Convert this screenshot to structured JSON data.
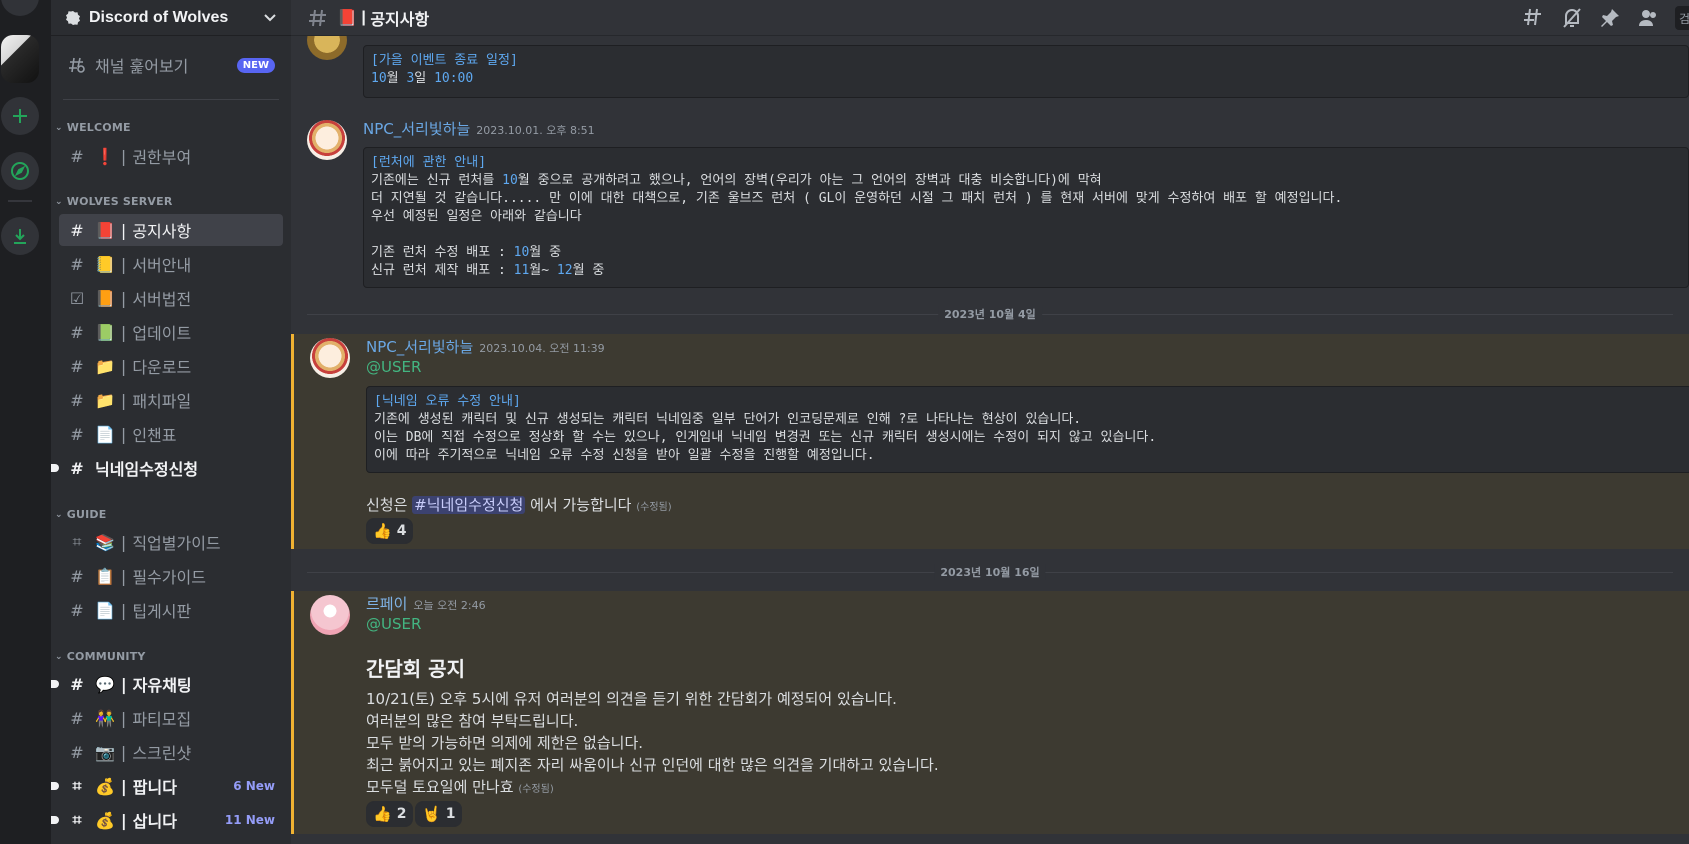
{
  "guild": {
    "name": "Discord of Wolves"
  },
  "sidebar": {
    "browse": {
      "label": "채널 훑어보기",
      "badge": "NEW"
    },
    "categories": [
      {
        "label": "WELCOME"
      },
      {
        "label": "WOLVES SERVER"
      },
      {
        "label": "GUIDE"
      },
      {
        "label": "COMMUNITY"
      }
    ],
    "channels": [
      {
        "label": "권한부여",
        "emoji": "❗"
      },
      {
        "label": "공지사항",
        "emoji": "📕"
      },
      {
        "label": "서버안내",
        "emoji": "📒"
      },
      {
        "label": "서버법전",
        "emoji": "📙"
      },
      {
        "label": "업데이트",
        "emoji": "📗"
      },
      {
        "label": "다운로드",
        "emoji": "📁"
      },
      {
        "label": "패치파일",
        "emoji": "📁"
      },
      {
        "label": "인챈표",
        "emoji": "📄"
      },
      {
        "label": "닉네임수정신청",
        "emoji": ""
      },
      {
        "label": "직업별가이드",
        "emoji": "📚"
      },
      {
        "label": "필수가이드",
        "emoji": "📋"
      },
      {
        "label": "팁게시판",
        "emoji": "📄"
      },
      {
        "label": "자유채팅",
        "emoji": "💬"
      },
      {
        "label": "파티모집",
        "emoji": "👫"
      },
      {
        "label": "스크린샷",
        "emoji": "📷"
      },
      {
        "label": "팝니다",
        "emoji": "💰",
        "new": "6 New"
      },
      {
        "label": "삽니다",
        "emoji": "💰",
        "new": "11 New"
      }
    ],
    "separator": "|"
  },
  "topbar": {
    "channel": "공지사항",
    "emoji": "📕",
    "search_placeholder": "검색"
  },
  "messages": {
    "m0": {
      "code_title": "[가을 이벤트 종료 일정]",
      "code_line_a": "10",
      "code_line_b": "월 ",
      "code_line_c": "3",
      "code_line_d": "일 ",
      "code_line_e": "10:00"
    },
    "m1": {
      "author": "NPC_서리빛하늘",
      "time": "2023.10.01. 오후 8:51",
      "code_title": "[런처에 관한 안내]",
      "l1a": "기존에는 신규 런처를 ",
      "l1n": "10",
      "l1b": "월 중으로 공개하려고 했으나, 언어의 장벽(우리가 아는 그 언어의 장벽과 대충 비슷합니다)에 막혀",
      "l2": "더 지연될 것 같습니다..... 만 이에 대한 대책으로, 기존 울브즈 런처 ( GL이 운영하던 시절 그 패치 런처 ) 를 현재 서버에 맞게 수정하여 배포 할 예정입니다.",
      "l3": "우선 예정된 일정은 아래와 같습니다",
      "l5a": "기존 런처 수정 배포 : ",
      "l5n": "10",
      "l5b": "월 중",
      "l6a": "신규 런처 제작 배포 : ",
      "l6n1": "11",
      "l6b": "월~ ",
      "l6n2": "12",
      "l6c": "월 중"
    },
    "date1": "2023년 10월 4일",
    "m2": {
      "author": "NPC_서리빛하늘",
      "time": "2023.10.04. 오전 11:39",
      "mention": "@USER",
      "code_title": "[닉네임 오류 수정 안내]",
      "l1": "기존에 생성된 캐릭터 및 신규 생성되는 캐릭터 닉네임중 일부 단어가 인코딩문제로 인해 ?로 나타나는 현상이 있습니다.",
      "l2": "이는 DB에 직접 수정으로 정상화 할 수는 있으나, 인게임내 닉네임 변경권 또는 신규 캐릭터 생성시에는 수정이 되지 않고 있습니다.",
      "l3": "이에 따라 주기적으로 닉네임 오류 수정 신청을 받아 일괄 수정을 진행할 예정입니다.",
      "text_a": "신청은 ",
      "chan": "#닉네임수정신청",
      "text_b": " 에서 가능합니다 ",
      "edited": "(수정됨)",
      "reaction_emoji": "👍",
      "reaction_count": "4"
    },
    "date2": "2023년 10월 16일",
    "m3": {
      "author": "르페이",
      "time": "오늘 오전 2:46",
      "mention": "@USER",
      "heading": "간담회 공지",
      "l1": "10/21(토) 오후 5시에 유저 여러분의 의견을 듣기 위한 간담회가 예정되어 있습니다.",
      "l2": "여러분의 많은 참여 부탁드립니다.",
      "l3": "모두 받의 가능하면 의제에 제한은 없습니다.",
      "l4": "최근 붉어지고 있는 폐지존 자리 싸움이나 신규 인던에 대한 많은 의견을 기대하고 있습니다.",
      "l5": "모두덜 토요일에 만나효 ",
      "edited": "(수정됨)",
      "r1_emoji": "👍",
      "r1_count": "2",
      "r2_emoji": "🤘",
      "r2_count": "1"
    }
  }
}
